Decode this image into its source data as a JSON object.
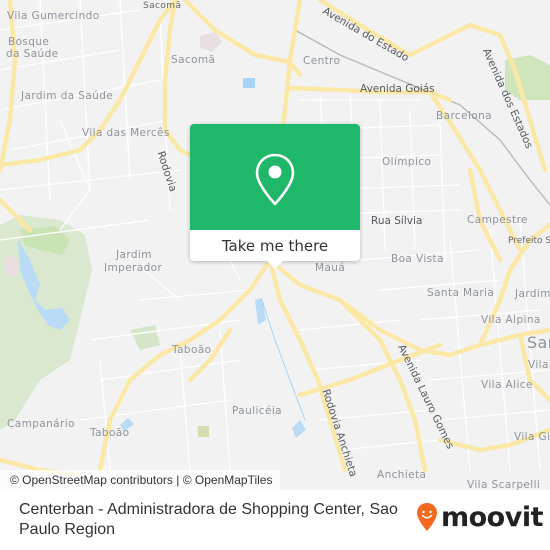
{
  "map": {
    "labels": [
      {
        "id": "vila-gumercindo",
        "text": "Vila Gumercindo"
      },
      {
        "id": "bosque-saude-1",
        "text": "Bosque"
      },
      {
        "id": "bosque-saude-2",
        "text": "da Saúde"
      },
      {
        "id": "sacoma-top",
        "text": "Sacomã"
      },
      {
        "id": "sacoma",
        "text": "Sacomã"
      },
      {
        "id": "jardim-da-saude",
        "text": "Jardim da Saúde"
      },
      {
        "id": "vila-das-merces",
        "text": "Vila das Mercês"
      },
      {
        "id": "rodovia-label",
        "text": "Rodovia"
      },
      {
        "id": "centro",
        "text": "Centro"
      },
      {
        "id": "avenida-do-estado",
        "text": "Avenida do Estado"
      },
      {
        "id": "avenida-goias",
        "text": "Avenida Goiás"
      },
      {
        "id": "avenida-dos-estados",
        "text": "Avenida dos Estados"
      },
      {
        "id": "barcelona",
        "text": "Barcelona"
      },
      {
        "id": "olimpico",
        "text": "Olímpico"
      },
      {
        "id": "rua-silvia",
        "text": "Rua Sílvia"
      },
      {
        "id": "campestre",
        "text": "Campestre"
      },
      {
        "id": "prefeito",
        "text": "Prefeito Sa"
      },
      {
        "id": "boa-vista",
        "text": "Boa Vista"
      },
      {
        "id": "maua",
        "text": "Mauá"
      },
      {
        "id": "jardim-imperador-1",
        "text": "Jardim"
      },
      {
        "id": "jardim-imperador-2",
        "text": "Imperador"
      },
      {
        "id": "santa-maria",
        "text": "Santa Maria"
      },
      {
        "id": "jardim-right",
        "text": "Jardim"
      },
      {
        "id": "vila-alpina",
        "text": "Vila Alpina"
      },
      {
        "id": "santo-andre",
        "text": "San"
      },
      {
        "id": "vila-right",
        "text": "Vila"
      },
      {
        "id": "taboao-1",
        "text": "Taboão"
      },
      {
        "id": "vila-alice",
        "text": "Vila Alice"
      },
      {
        "id": "avenida-lauro-gomes",
        "text": "Avenida Lauro Gomes"
      },
      {
        "id": "rodovia-anchieta",
        "text": "Rodovia Anchieta"
      },
      {
        "id": "paulicea",
        "text": "Paulicéia"
      },
      {
        "id": "campanario",
        "text": "Campanário"
      },
      {
        "id": "taboao-2",
        "text": "Taboão"
      },
      {
        "id": "vila-gi",
        "text": "Vila Gi"
      },
      {
        "id": "anchieta",
        "text": "Anchieta"
      },
      {
        "id": "vila-scarpelli",
        "text": "Vila Scarpelli"
      }
    ],
    "colors": {
      "background": "#f2f2f3",
      "major_road": "#fbe8a6",
      "minor_road": "#ffffff",
      "park": "#cfe3c1",
      "water": "#a9d3f5",
      "railway": "#b4b4b4"
    }
  },
  "popup": {
    "icon": "map-pin-icon",
    "color": "#1fb86a",
    "cta_label": "Take me there"
  },
  "attribution": "© OpenStreetMap contributors | © OpenMapTiles",
  "footer": {
    "place_name": "Centerban - Administradora de Shopping Center, Sao Paulo Region",
    "brand": "moovit",
    "brand_color": "#f26a21"
  }
}
